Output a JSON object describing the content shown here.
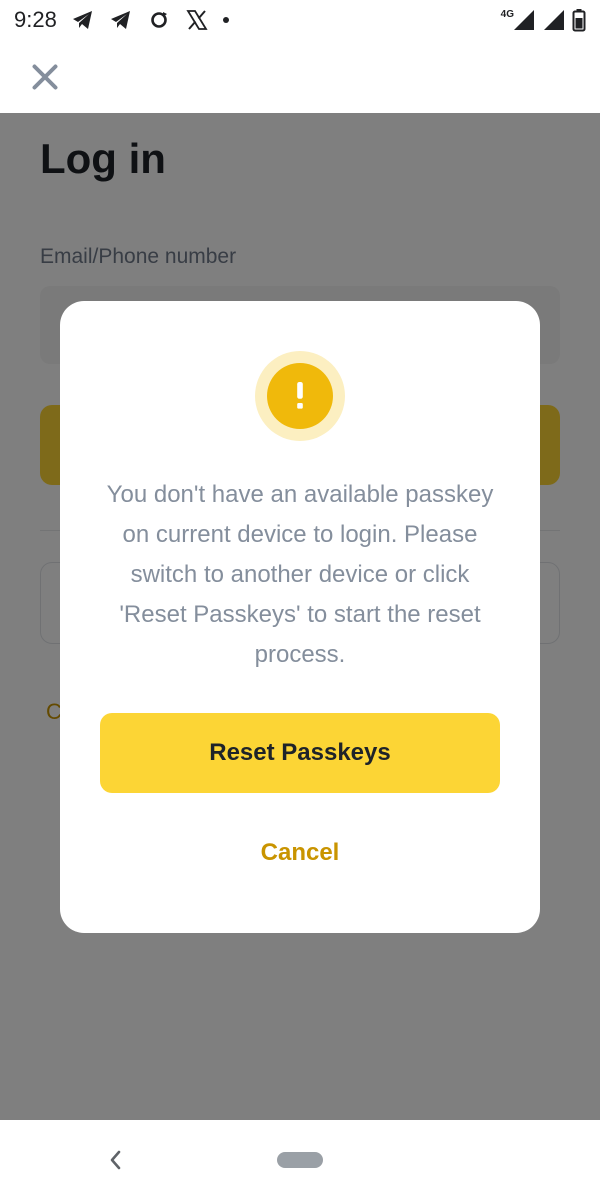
{
  "status_bar": {
    "time": "9:28",
    "left_icons": [
      "telegram-icon",
      "telegram-icon",
      "sync-icon",
      "x-logo-icon",
      "notification-dot-icon"
    ],
    "network_label": "4G",
    "right_icons": [
      "signal-icon",
      "signal-icon",
      "battery-icon"
    ]
  },
  "top_bar": {
    "close_icon": "close-icon"
  },
  "page": {
    "title": "Log in",
    "email_label": "Email/Phone number",
    "link_partial": "C"
  },
  "modal": {
    "icon": "warning-icon",
    "icon_color": "#f0b90b",
    "message": "You don't have an available passkey on current device to login. Please switch to another device or click 'Reset Passkeys' to start the reset process.",
    "primary_button": "Reset Passkeys",
    "secondary_button": "Cancel"
  },
  "nav_bar": {
    "back_icon": "back-chevron-icon",
    "home_icon": "home-pill-icon"
  },
  "colors": {
    "accent": "#fcd535",
    "link": "#c99400",
    "overlay": "rgba(0,0,0,0.5)"
  }
}
